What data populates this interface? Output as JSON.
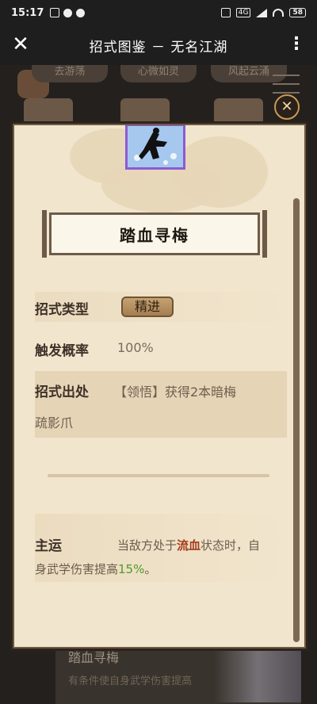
{
  "status_bar": {
    "time": "15:17",
    "network": "4G",
    "battery": "58"
  },
  "header": {
    "title": "招式图鉴 － 无名江湖"
  },
  "background": {
    "tabs": [
      "去游荡",
      "心微如灵",
      "风起云涌"
    ],
    "bottom_card": {
      "name": "踏血寻梅",
      "desc": "有条件使自身武学伤害提高"
    }
  },
  "skill": {
    "name": "踏血寻梅",
    "fields": {
      "type_label": "招式类型",
      "type_value": "精进",
      "trigger_label": "触发概率",
      "trigger_value": "100%",
      "source_label": "招式出处",
      "source_line1": "【领悟】获得2本暗梅",
      "source_line2": "疏影爪"
    },
    "effect": {
      "label": "主运",
      "line1_prefix": "当敌方处于",
      "line1_highlight": "流血",
      "line1_suffix": "状态时，自",
      "line2_prefix": "身武学伤害提高",
      "line2_highlight": "15%",
      "line2_suffix": "。"
    }
  },
  "colors": {
    "dialog_bg": "#f1e5cd",
    "highlight_red": "#a43c1c",
    "highlight_green": "#4f9b2b",
    "icon_border": "#8b5bd4"
  }
}
